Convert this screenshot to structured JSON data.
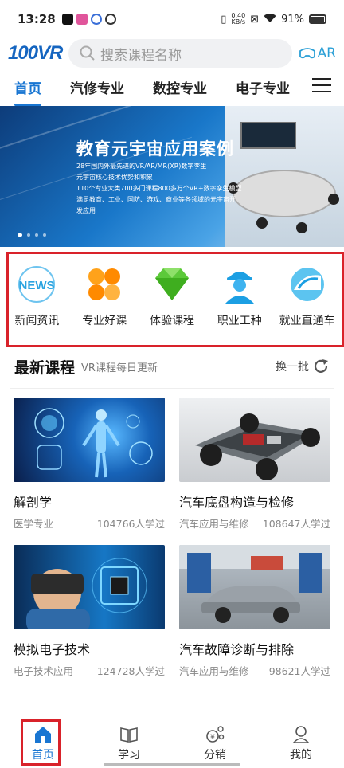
{
  "status_bar": {
    "time": "13:28",
    "net_speed": "0.40",
    "net_unit": "KB/s",
    "battery": "91%"
  },
  "header": {
    "logo": "100VR",
    "search_placeholder": "搜索课程名称",
    "ar_label": "AR"
  },
  "tabs": [
    {
      "label": "首页",
      "active": true
    },
    {
      "label": "汽修专业",
      "active": false
    },
    {
      "label": "数控专业",
      "active": false
    },
    {
      "label": "电子专业",
      "active": false
    }
  ],
  "banner": {
    "title": "教育元宇宙应用案例",
    "lines": [
      "28年国内外最先进的VR/AR/MR(XR)数字孪生",
      "元宇宙核心技术优势和积累",
      "110个专业大类700多门课程800多万个VR+数字孪生模型",
      "满足教育、工业、国防、游戏、商业等各领域的元宇宙开",
      "发应用"
    ]
  },
  "categories": [
    {
      "label": "新闻资讯",
      "icon": "news-icon"
    },
    {
      "label": "专业好课",
      "icon": "clover-icon"
    },
    {
      "label": "体验课程",
      "icon": "diamond-icon"
    },
    {
      "label": "职业工种",
      "icon": "worker-icon"
    },
    {
      "label": "就业直通车",
      "icon": "train-icon"
    }
  ],
  "section": {
    "title": "最新课程",
    "subtitle": "VR课程每日更新",
    "refresh_label": "换一批"
  },
  "courses": [
    {
      "name": "解剖学",
      "category": "医学专业",
      "learners": "104766人学过"
    },
    {
      "name": "汽车底盘构造与检修",
      "category": "汽车应用与维修",
      "learners": "108647人学过"
    },
    {
      "name": "模拟电子技术",
      "category": "电子技术应用",
      "learners": "124728人学过"
    },
    {
      "name": "汽车故障诊断与排除",
      "category": "汽车应用与维修",
      "learners": "98621人学过"
    }
  ],
  "bottom_nav": [
    {
      "label": "首页",
      "icon": "home-icon",
      "active": true
    },
    {
      "label": "学习",
      "icon": "book-icon",
      "active": false
    },
    {
      "label": "分销",
      "icon": "share-money-icon",
      "active": false
    },
    {
      "label": "我的",
      "icon": "user-icon",
      "active": false
    }
  ],
  "colors": {
    "accent": "#1976d2",
    "highlight_box": "#d9222a"
  }
}
